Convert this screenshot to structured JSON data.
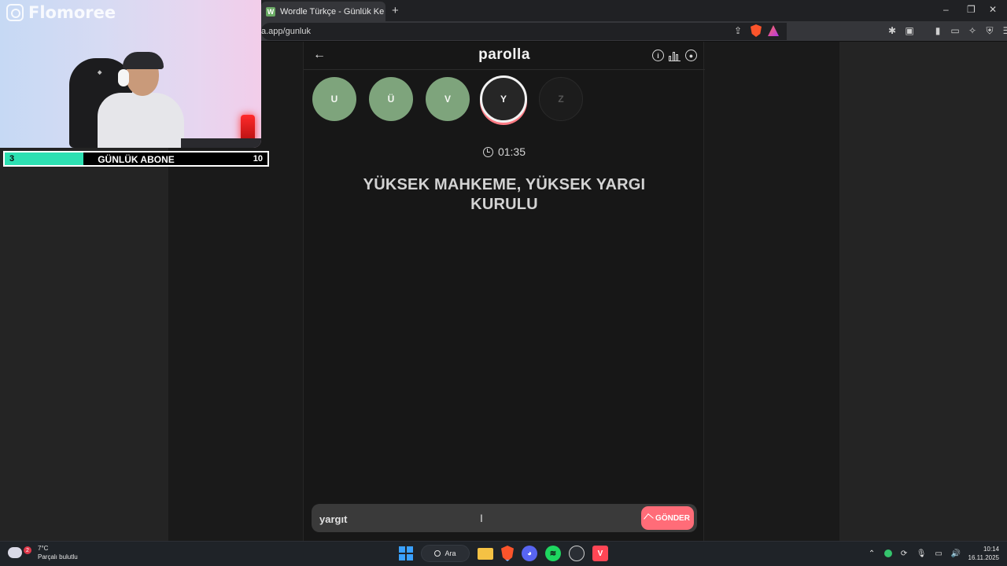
{
  "browser": {
    "tab_title": "Wordle Türkçe - Günlük Kelime Oyunu",
    "tab_favicon": "W",
    "url": "a.app/gunluk"
  },
  "app": {
    "title": "parolla",
    "letters": [
      {
        "char": "U",
        "state": "done"
      },
      {
        "char": "Ü",
        "state": "done"
      },
      {
        "char": "V",
        "state": "done"
      },
      {
        "char": "Y",
        "state": "active"
      },
      {
        "char": "Z",
        "state": "todo"
      }
    ],
    "timer": "01:35",
    "clue": "YÜKSEK MAHKEME, YÜKSEK YARGI KURULU",
    "answer_value": "yargıt",
    "send_label": "GÖNDER"
  },
  "overlay": {
    "handle": "Flomoree",
    "sub_current": "3",
    "sub_label": "GÜNLÜK ABONE",
    "sub_goal": "10",
    "sub_progress": 0.3
  },
  "taskbar": {
    "temperature": "7°C",
    "weather": "Parçalı bulutlu",
    "weather_badge": "2",
    "search_label": "Ara",
    "time": "10:14",
    "date": "16.11.2025"
  },
  "colors": {
    "done": "#7ea47c",
    "accent": "#ff6c78",
    "sub_fill": "#2de0b2"
  }
}
